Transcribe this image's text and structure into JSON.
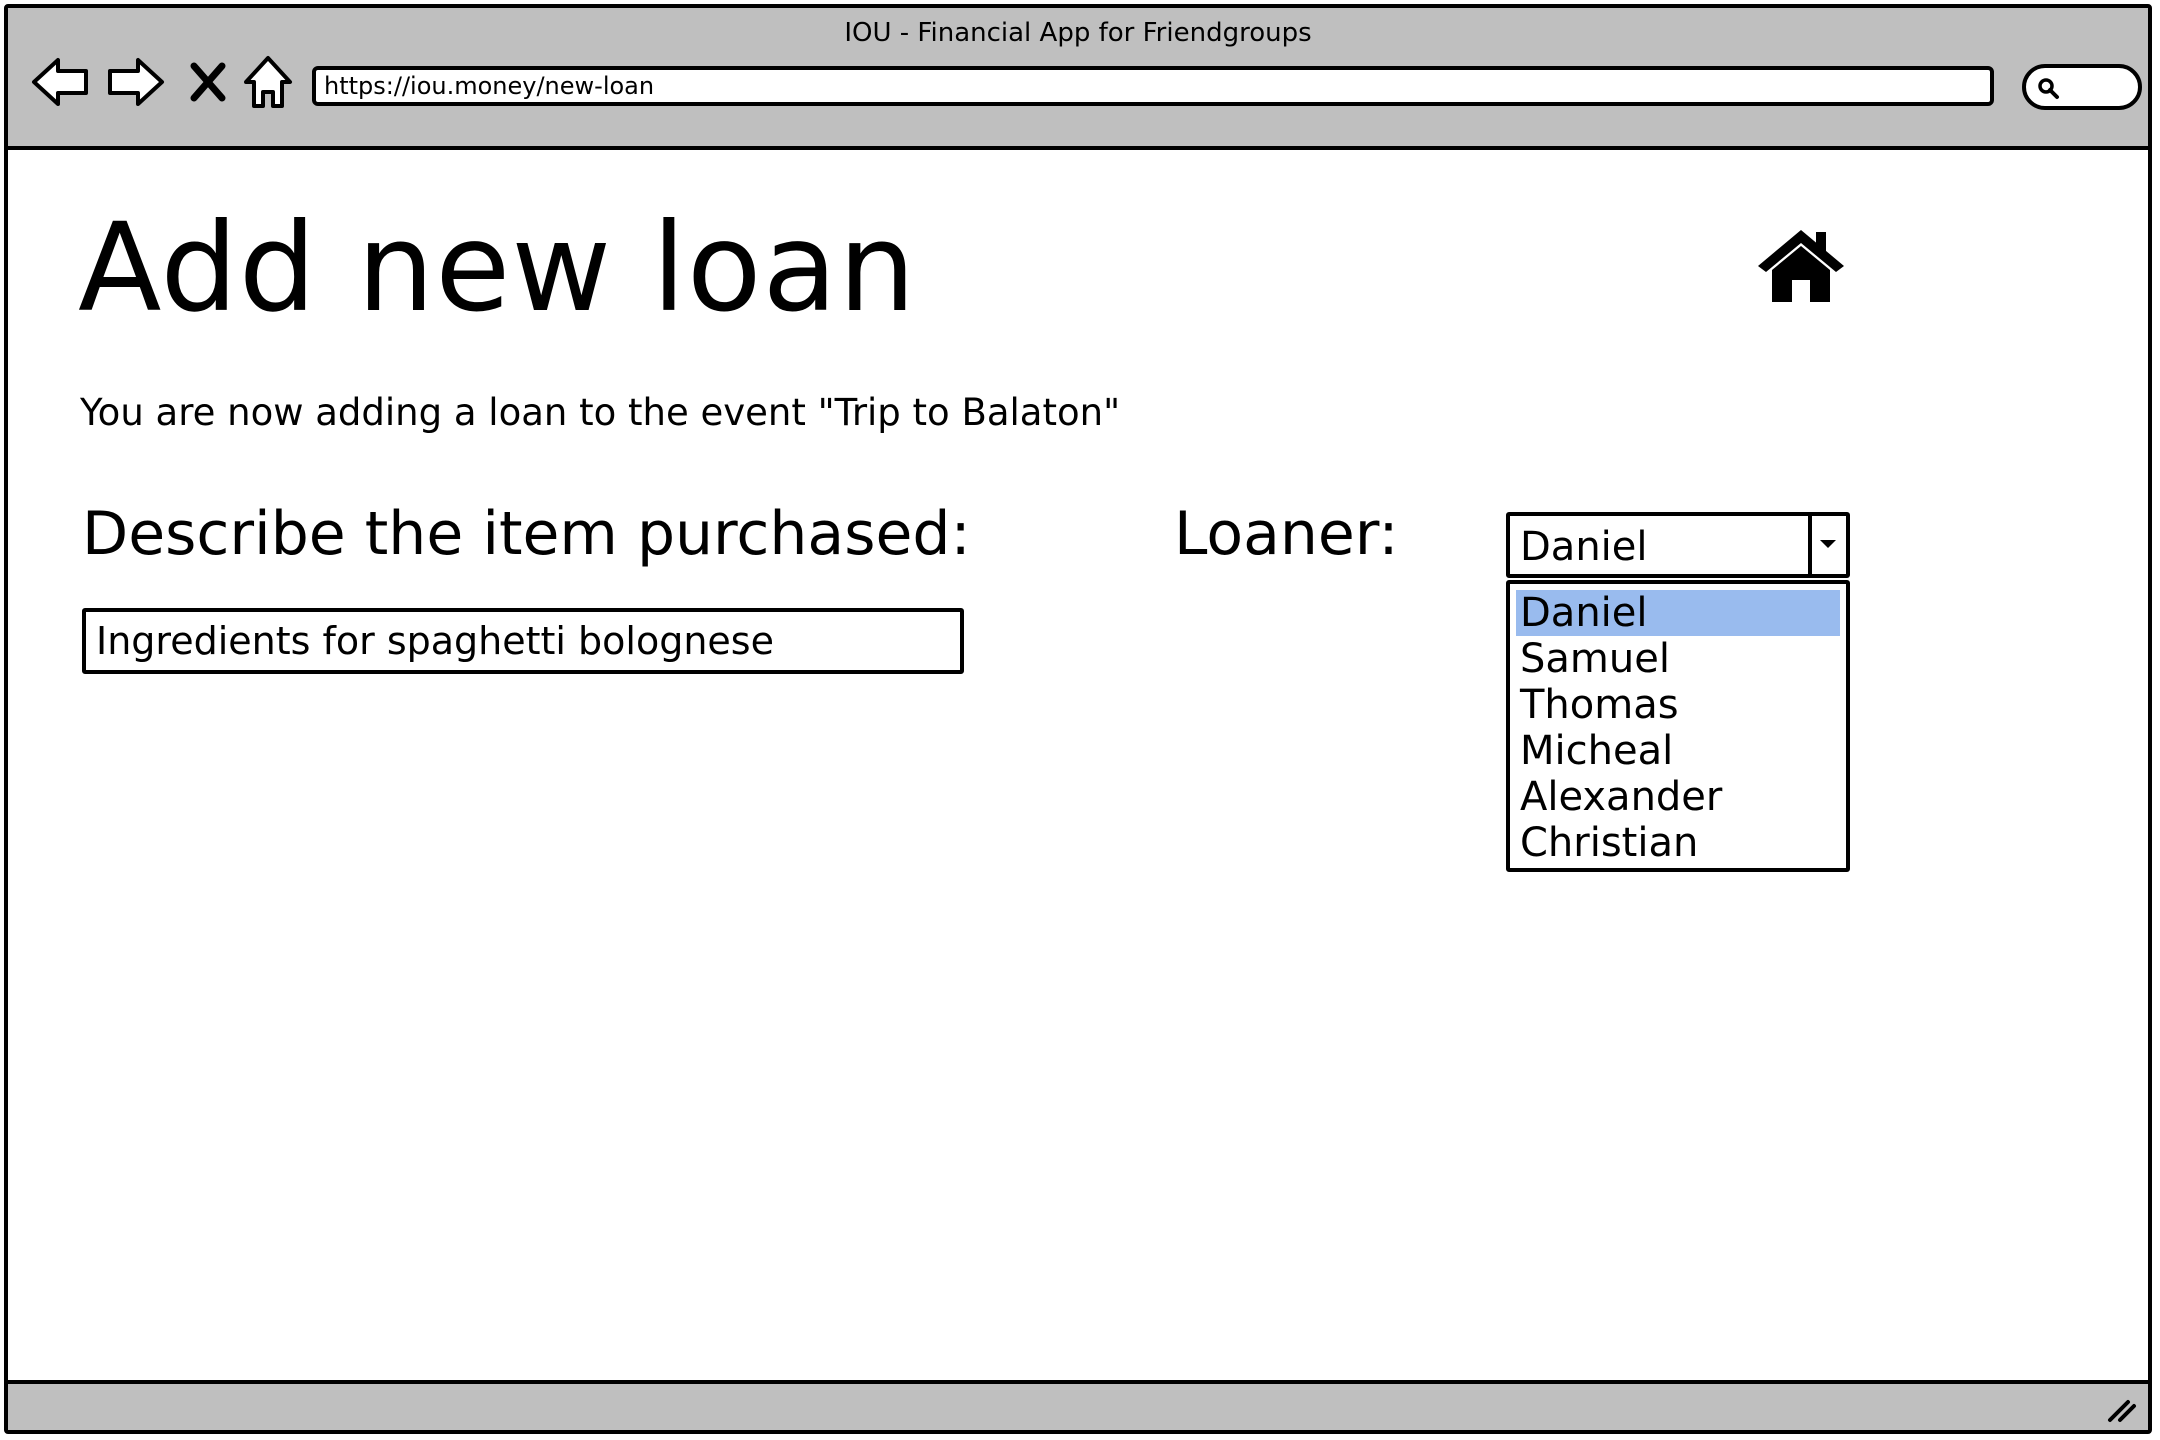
{
  "window": {
    "title": "IOU - Financial App for Friendgroups",
    "url": "https://iou.money/new-loan"
  },
  "page": {
    "title": "Add new loan",
    "subtitle": "You are now adding a loan to the event \"Trip to Balaton\"",
    "item_label": "Describe the item purchased:",
    "item_value": "Ingredients for spaghetti bolognese",
    "loaner_label": "Loaner:",
    "loaner_selected": "Daniel",
    "loaner_options": [
      "Daniel",
      "Samuel",
      "Thomas",
      "Micheal",
      "Alexander",
      "Christian"
    ]
  },
  "colors": {
    "chrome": "#bfbfbf",
    "selection_highlight": "#99bbee"
  },
  "icons": [
    "back-arrow-icon",
    "forward-arrow-icon",
    "stop-icon",
    "home-icon",
    "search-icon",
    "resize-grip-icon"
  ]
}
